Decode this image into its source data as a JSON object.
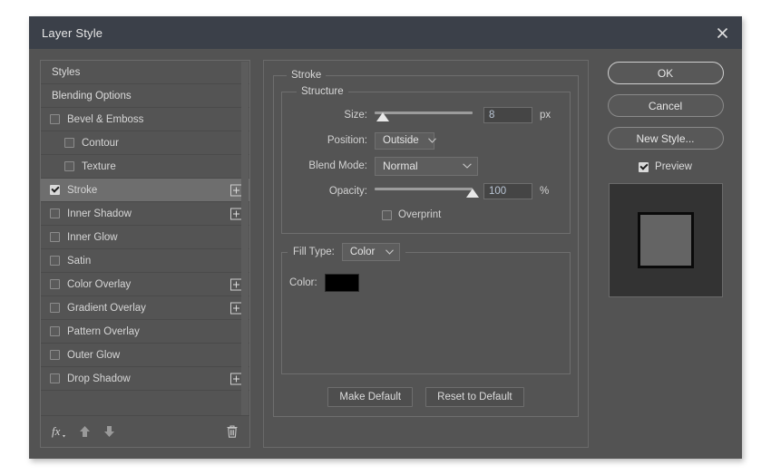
{
  "window": {
    "title": "Layer Style",
    "close_icon": "close-icon"
  },
  "sidebar": {
    "items": [
      {
        "label": "Styles",
        "type": "plain",
        "checked": false,
        "indent": false,
        "plus": false,
        "selected": false
      },
      {
        "label": "Blending Options",
        "type": "plain",
        "checked": false,
        "indent": false,
        "plus": false,
        "selected": false
      },
      {
        "label": "Bevel & Emboss",
        "type": "check",
        "checked": false,
        "indent": false,
        "plus": false,
        "selected": false
      },
      {
        "label": "Contour",
        "type": "check",
        "checked": false,
        "indent": true,
        "plus": false,
        "selected": false
      },
      {
        "label": "Texture",
        "type": "check",
        "checked": false,
        "indent": true,
        "plus": false,
        "selected": false
      },
      {
        "label": "Stroke",
        "type": "check",
        "checked": true,
        "indent": false,
        "plus": true,
        "selected": true
      },
      {
        "label": "Inner Shadow",
        "type": "check",
        "checked": false,
        "indent": false,
        "plus": true,
        "selected": false
      },
      {
        "label": "Inner Glow",
        "type": "check",
        "checked": false,
        "indent": false,
        "plus": false,
        "selected": false
      },
      {
        "label": "Satin",
        "type": "check",
        "checked": false,
        "indent": false,
        "plus": false,
        "selected": false
      },
      {
        "label": "Color Overlay",
        "type": "check",
        "checked": false,
        "indent": false,
        "plus": true,
        "selected": false
      },
      {
        "label": "Gradient Overlay",
        "type": "check",
        "checked": false,
        "indent": false,
        "plus": true,
        "selected": false
      },
      {
        "label": "Pattern Overlay",
        "type": "check",
        "checked": false,
        "indent": false,
        "plus": false,
        "selected": false
      },
      {
        "label": "Outer Glow",
        "type": "check",
        "checked": false,
        "indent": false,
        "plus": false,
        "selected": false
      },
      {
        "label": "Drop Shadow",
        "type": "check",
        "checked": false,
        "indent": false,
        "plus": true,
        "selected": false
      }
    ],
    "toolbar": {
      "fx_icon": "fx-icon",
      "move_up_icon": "arrow-up-icon",
      "move_down_icon": "arrow-down-icon",
      "delete_icon": "trash-icon"
    }
  },
  "settings": {
    "section_title": "Stroke",
    "structure": {
      "legend": "Structure",
      "size": {
        "label": "Size:",
        "value": "8",
        "unit": "px",
        "slider_percent": 8
      },
      "position": {
        "label": "Position:",
        "value": "Outside"
      },
      "blend_mode": {
        "label": "Blend Mode:",
        "value": "Normal"
      },
      "opacity": {
        "label": "Opacity:",
        "value": "100",
        "unit": "%",
        "slider_percent": 100
      },
      "overprint": {
        "label": "Overprint",
        "checked": false
      }
    },
    "fill_type": {
      "label": "Fill Type:",
      "value": "Color",
      "color_label": "Color:",
      "color_value": "#000000"
    },
    "make_default_label": "Make Default",
    "reset_default_label": "Reset to Default"
  },
  "actions": {
    "ok_label": "OK",
    "cancel_label": "Cancel",
    "new_style_label": "New Style...",
    "preview": {
      "label": "Preview",
      "checked": true
    },
    "preview_swatch_fill": "#646464",
    "preview_swatch_stroke": "#0a0a0a",
    "preview_background": "#333333"
  }
}
